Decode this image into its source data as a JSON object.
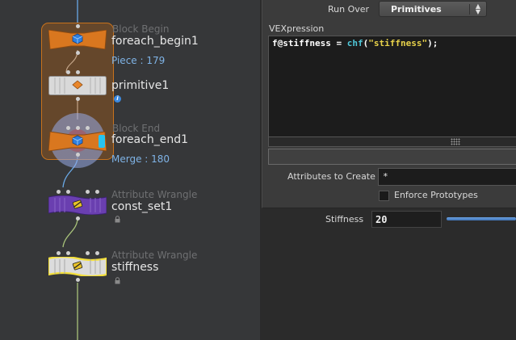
{
  "network": {
    "nodes": [
      {
        "id": "foreach_begin1",
        "type": "Block Begin",
        "name": "foreach_begin1",
        "info": "Piece : 179",
        "color": "#d9771f"
      },
      {
        "id": "primitive1",
        "type": "",
        "name": "primitive1",
        "info": "",
        "color": "#d9d9d9"
      },
      {
        "id": "foreach_end1",
        "type": "Block End",
        "name": "foreach_end1",
        "info": "Merge : 180",
        "color": "#d9771f"
      },
      {
        "id": "const_set1",
        "type": "Attribute Wrangle",
        "name": "const_set1",
        "info": "",
        "color": "#6a3fb0"
      },
      {
        "id": "stiffness",
        "type": "Attribute Wrangle",
        "name": "stiffness",
        "info": "",
        "color": "#d9d9d9",
        "selected": true
      }
    ],
    "colors": {
      "block_group": "#c8721c",
      "wire_blue": "#6aa9e6",
      "wire_green": "#a8c27a",
      "selected_outline": "#f4e03c"
    }
  },
  "params": {
    "run_over": {
      "label": "Run Over",
      "value": "Primitives"
    },
    "vexpression": {
      "label": "VEXpression",
      "code": "f@stiffness = chf(\"stiffness\");",
      "tokens": {
        "var": "f@stiffness",
        "op": " = ",
        "fn": "chf",
        "open": "(",
        "str": "\"stiffness\"",
        "close": ");"
      }
    },
    "attributes_to_create": {
      "label": "Attributes to Create",
      "value": "*"
    },
    "enforce_prototypes": {
      "label": "Enforce Prototypes",
      "checked": false
    },
    "stiffness": {
      "label": "Stiffness",
      "value": "20",
      "slider_fraction": 0.2
    }
  },
  "icons": [
    "select-arrows-icon",
    "lock-icon",
    "info-icon",
    "node-operator-icon",
    "resize-grip-icon"
  ]
}
